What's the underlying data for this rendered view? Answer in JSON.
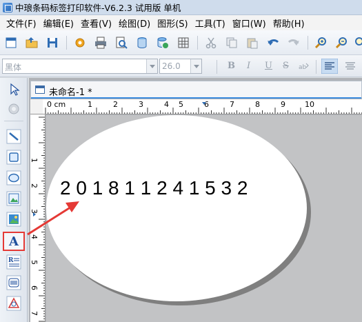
{
  "titlebar": {
    "title": "中琅条码标签打印软件-V6.2.3 试用版 单机"
  },
  "menu": {
    "items": [
      {
        "label": "文件(F)"
      },
      {
        "label": "编辑(E)"
      },
      {
        "label": "查看(V)"
      },
      {
        "label": "绘图(D)"
      },
      {
        "label": "图形(S)"
      },
      {
        "label": "工具(T)"
      },
      {
        "label": "窗口(W)"
      },
      {
        "label": "帮助(H)"
      }
    ]
  },
  "format_bar": {
    "font_name": "黑体",
    "font_size": "26.0",
    "bold": "B",
    "italic": "I",
    "underline": "U",
    "strikeout": "S"
  },
  "document": {
    "tab_title": "未命名-1 *",
    "ruler_unit": "0 cm",
    "ruler_h_ticks": [
      "1",
      "2",
      "3",
      "4",
      "5",
      "6",
      "7",
      "8",
      "9",
      "10"
    ],
    "ruler_v_ticks": [
      "1",
      "2",
      "3",
      "4",
      "5",
      "6",
      "7"
    ]
  },
  "label": {
    "text": "2 0 1 8 1 1 2 4 1 5 3 2"
  },
  "colors": {
    "highlight": "#e53935",
    "label_background": "#ffffff",
    "canvas_background": "#c2c3c5"
  }
}
